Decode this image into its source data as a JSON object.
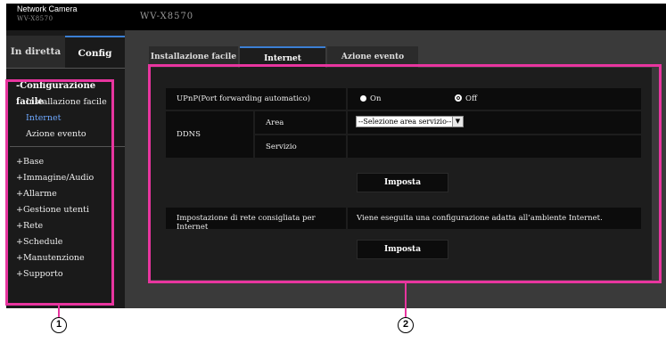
{
  "header": {
    "brand": "Network Camera",
    "model_small": "WV-X8570",
    "model_large": "WV-X8570"
  },
  "sidebar": {
    "tabs": [
      {
        "label": "In diretta",
        "active": false
      },
      {
        "label": "Config",
        "active": true
      }
    ],
    "setup_head": "-Configurazione facile",
    "setup_items": [
      "Installazione facile",
      "Internet",
      "Azione evento"
    ],
    "current_item": "Internet",
    "menu_items": [
      "+Base",
      "+Immagine/Audio",
      "+Allarme",
      "+Gestione utenti",
      "+Rete",
      "+Schedule",
      "+Manutenzione",
      "+Supporto"
    ]
  },
  "main": {
    "tabs": [
      {
        "label": "Installazione facile",
        "active": false
      },
      {
        "label": "Internet",
        "active": true
      },
      {
        "label": "Azione evento",
        "active": false
      }
    ],
    "upnp": {
      "label": "UPnP(Port forwarding automatico)",
      "option_on": "On",
      "option_off": "Off",
      "selected": "Off"
    },
    "ddns": {
      "label": "DDNS",
      "area_label": "Area",
      "area_value": "--Selezione area servizio--",
      "servizio_label": "Servizio",
      "servizio_value": ""
    },
    "apply_button": "Imposta",
    "net_setting": {
      "label": "Impostazione di rete consigliata per Internet",
      "description": "Viene eseguita una configurazione adatta all’ambiente Internet."
    },
    "apply_button_2": "Imposta"
  },
  "callouts": [
    "1",
    "2"
  ],
  "colors": {
    "highlight": "#e8359f",
    "active_tab_border": "#3b7fd4",
    "current_item": "#6ea8ff"
  }
}
